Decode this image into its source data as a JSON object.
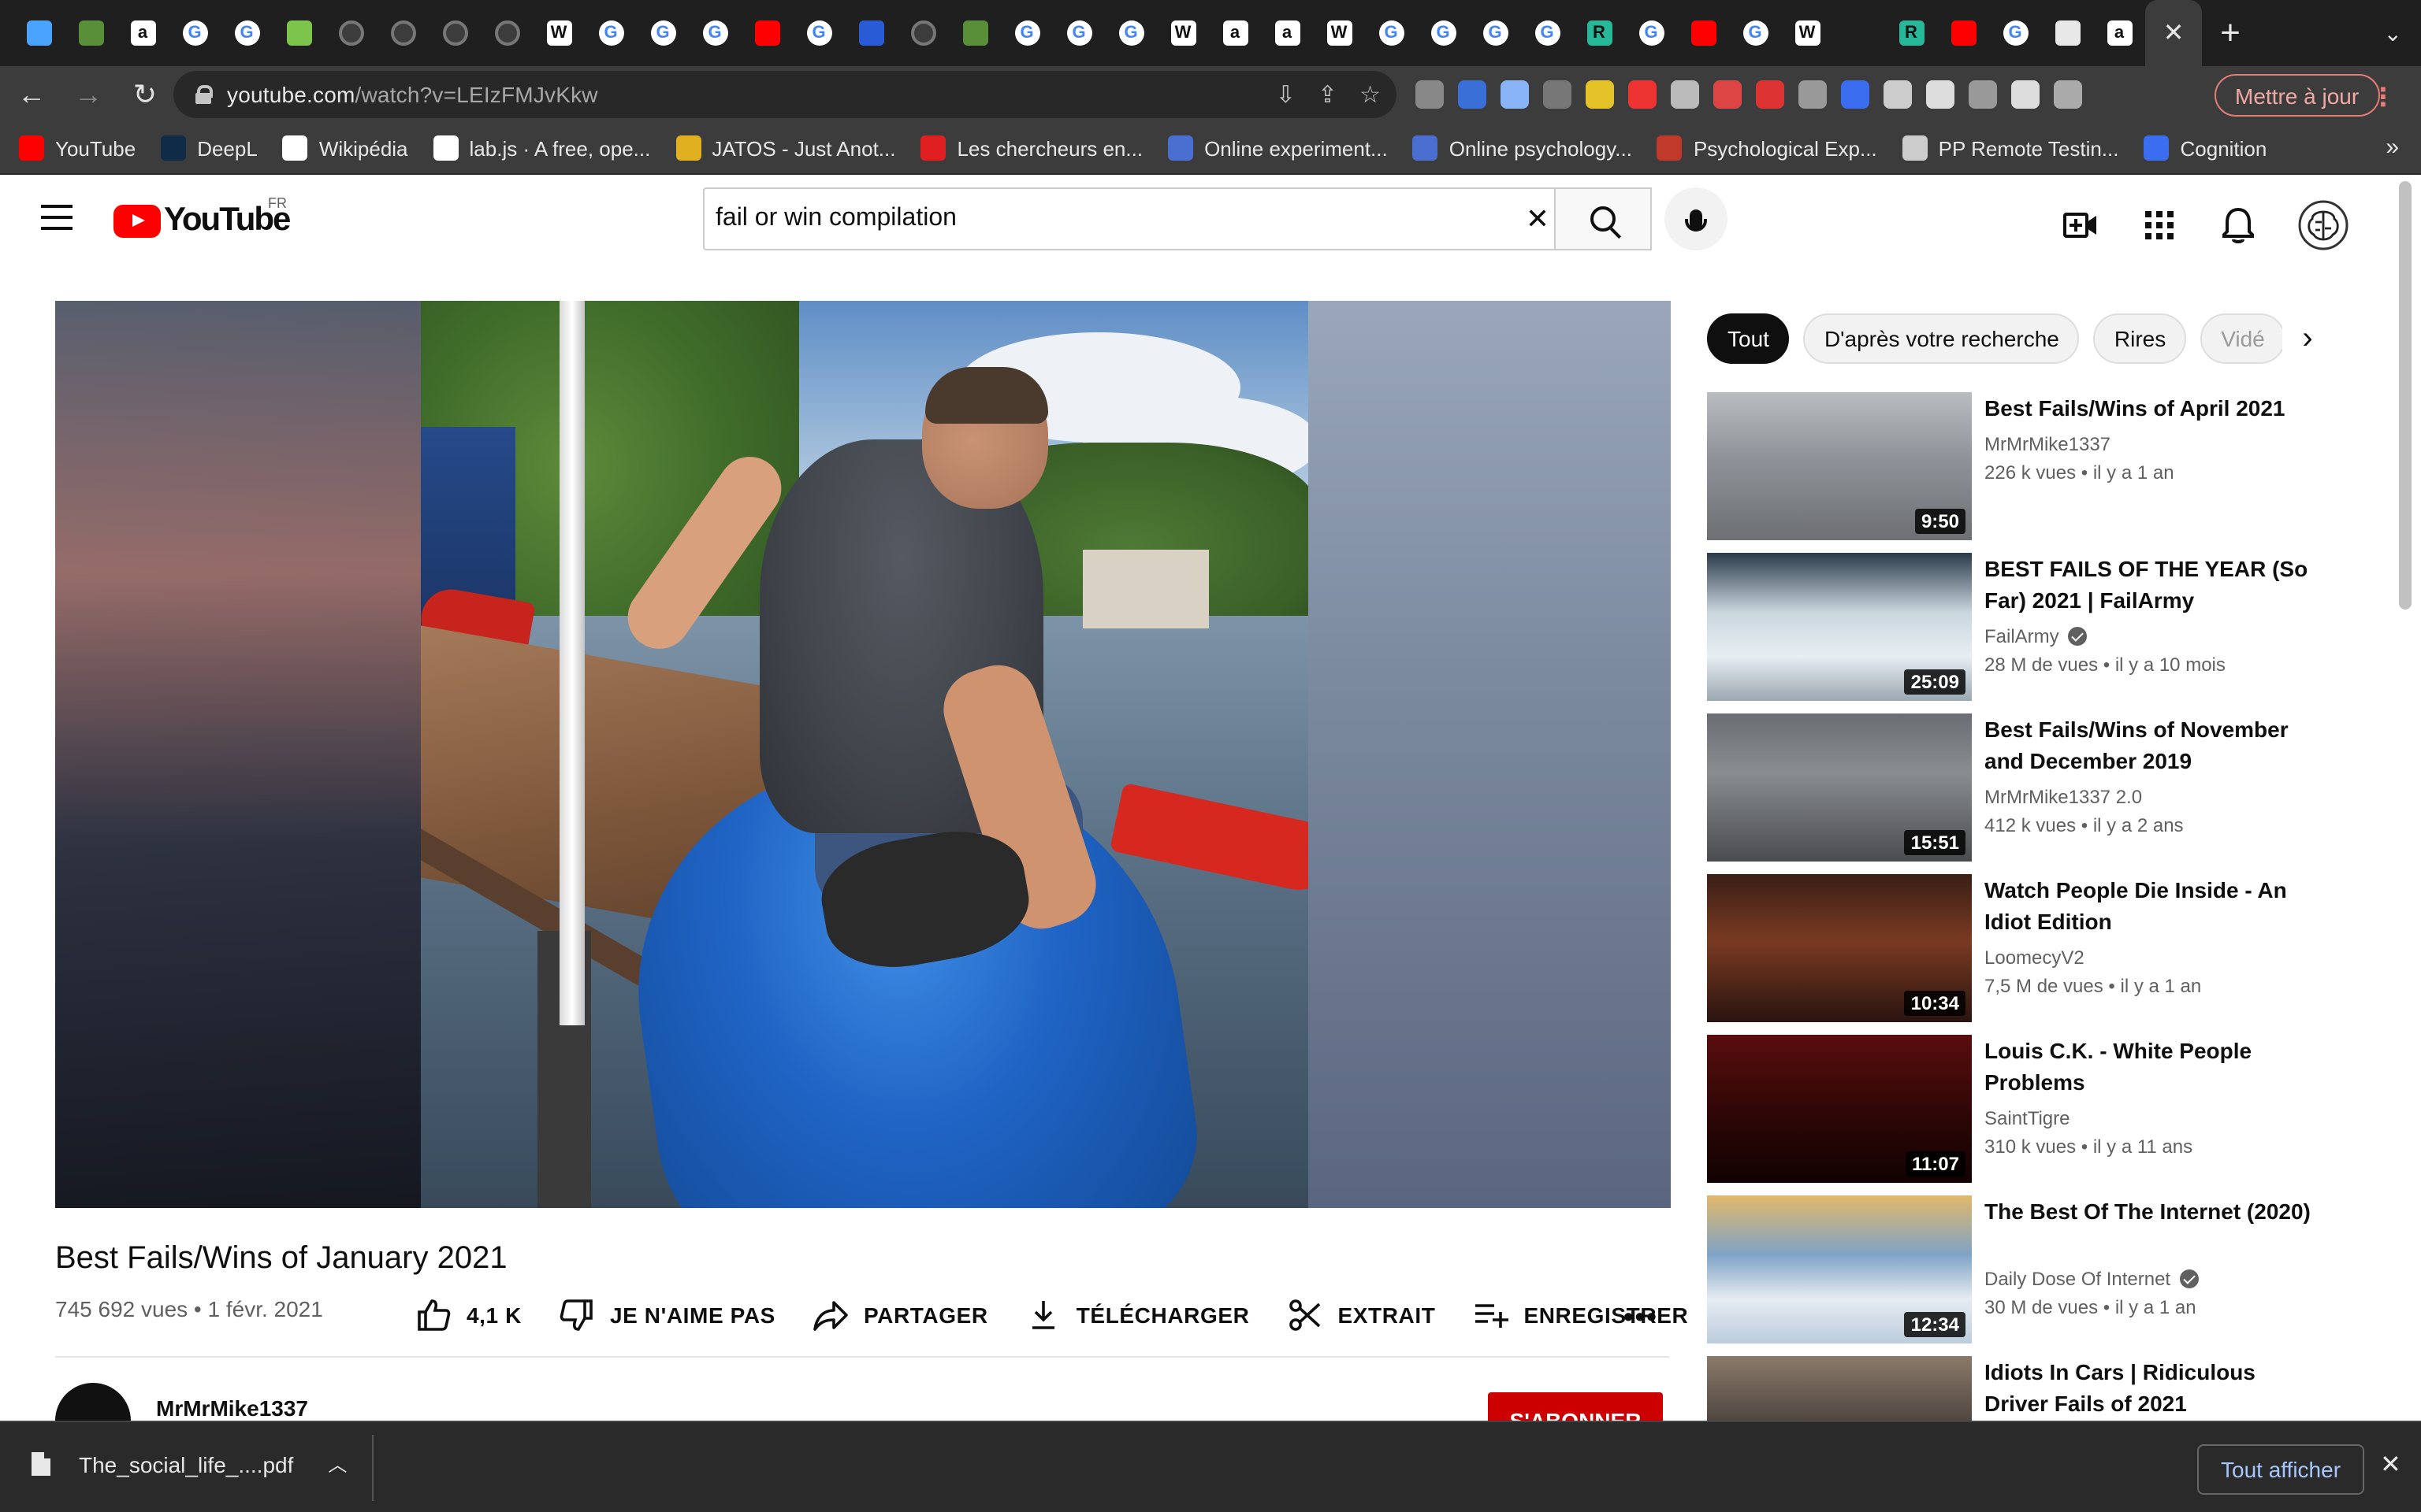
{
  "browser": {
    "url_host": "youtube.com",
    "url_path": "/watch?v=LEIzFMJvKkw",
    "update_button": "Mettre à jour",
    "active_tab_close": "✕",
    "new_tab": "+",
    "tab_icons": [
      "diamond-icon",
      "ladybug-icon",
      "amazon-icon",
      "google-icon",
      "google-icon",
      "refresh-icon",
      "github-icon",
      "github-icon",
      "github-icon",
      "github-icon",
      "wikipedia-icon",
      "google-icon",
      "google-icon",
      "google-icon",
      "youtube-icon",
      "google-icon",
      "blue-icon",
      "github-icon",
      "ladybug-icon",
      "google-icon",
      "google-icon",
      "google-icon",
      "wikipedia-icon",
      "amazon-icon",
      "amazon-icon",
      "wikipedia-icon",
      "google-icon",
      "google-icon",
      "google-icon",
      "google-icon",
      "r-icon",
      "google-icon",
      "youtube-icon",
      "google-icon",
      "wikipedia-icon",
      "blue-bar-icon",
      "r-icon",
      "youtube-icon",
      "google-icon",
      "globe-icon",
      "amazon-icon"
    ]
  },
  "bookmarks": [
    {
      "label": "YouTube",
      "icon": "youtube-icon",
      "color": "#ff0000"
    },
    {
      "label": "DeepL",
      "icon": "deepl-icon",
      "color": "#0f2b46"
    },
    {
      "label": "Wikipédia",
      "icon": "wikipedia-icon",
      "color": "#ffffff"
    },
    {
      "label": "lab.js · A free, ope...",
      "icon": "labjs-icon",
      "color": "#ffffff"
    },
    {
      "label": "JATOS - Just Anot...",
      "icon": "jatos-icon",
      "color": "#e0b020"
    },
    {
      "label": "Les chercheurs en...",
      "icon": "speech-icon",
      "color": "#e02020"
    },
    {
      "label": "Online experiment...",
      "icon": "p-icon",
      "color": "#4a6fd1"
    },
    {
      "label": "Online psychology...",
      "icon": "p-icon",
      "color": "#4a6fd1"
    },
    {
      "label": "Psychological Exp...",
      "icon": "psy-icon",
      "color": "#c0392b"
    },
    {
      "label": "PP Remote Testin...",
      "icon": "globe-icon",
      "color": "#cccccc"
    },
    {
      "label": "Cognition",
      "icon": "cognition-icon",
      "color": "#3a6df0"
    }
  ],
  "bookmarks_more": "»",
  "youtube": {
    "logo_text": "YouTube",
    "country": "FR",
    "search_query": "fail or win compilation"
  },
  "video": {
    "title": "Best Fails/Wins of January 2021",
    "meta": "745 692 vues • 1 févr. 2021",
    "likes": "4,1 K",
    "dislike": "JE N'AIME PAS",
    "share": "PARTAGER",
    "download": "TÉLÉCHARGER",
    "clip": "EXTRAIT",
    "save": "ENREGISTRER",
    "channel": "MrMrMike1337",
    "subscribe": "S'ABONNER"
  },
  "chips": [
    "Tout",
    "D'après votre recherche",
    "Rires",
    "Vidé"
  ],
  "recommendations": [
    {
      "title": "Best Fails/Wins of April 2021",
      "channel": "MrMrMike1337",
      "verified": false,
      "stats": "226 k vues • il y a 1 an",
      "duration": "9:50"
    },
    {
      "title": "BEST FAILS OF THE YEAR (So Far) 2021 | FailArmy",
      "channel": "FailArmy",
      "verified": true,
      "stats": "28 M de vues • il y a 10 mois",
      "duration": "25:09"
    },
    {
      "title": "Best Fails/Wins of November and December 2019",
      "channel": "MrMrMike1337 2.0",
      "verified": false,
      "stats": "412 k vues • il y a 2 ans",
      "duration": "15:51"
    },
    {
      "title": "Watch People Die Inside - An Idiot Edition",
      "channel": "LoomecyV2",
      "verified": false,
      "stats": "7,5 M de vues • il y a 1 an",
      "duration": "10:34"
    },
    {
      "title": "Louis C.K. - White People Problems",
      "channel": "SaintTigre",
      "verified": false,
      "stats": "310 k vues • il y a 11 ans",
      "duration": "11:07"
    },
    {
      "title": "The Best Of The Internet (2020)",
      "channel": "Daily Dose Of Internet",
      "verified": true,
      "stats": "30 M de vues • il y a 1 an",
      "duration": "12:34"
    },
    {
      "title": "Idiots In Cars | Ridiculous Driver Fails of 2021",
      "channel": "",
      "verified": false,
      "stats": "",
      "duration": ""
    }
  ],
  "download_bar": {
    "filename": "The_social_life_....pdf",
    "show_all": "Tout afficher"
  }
}
